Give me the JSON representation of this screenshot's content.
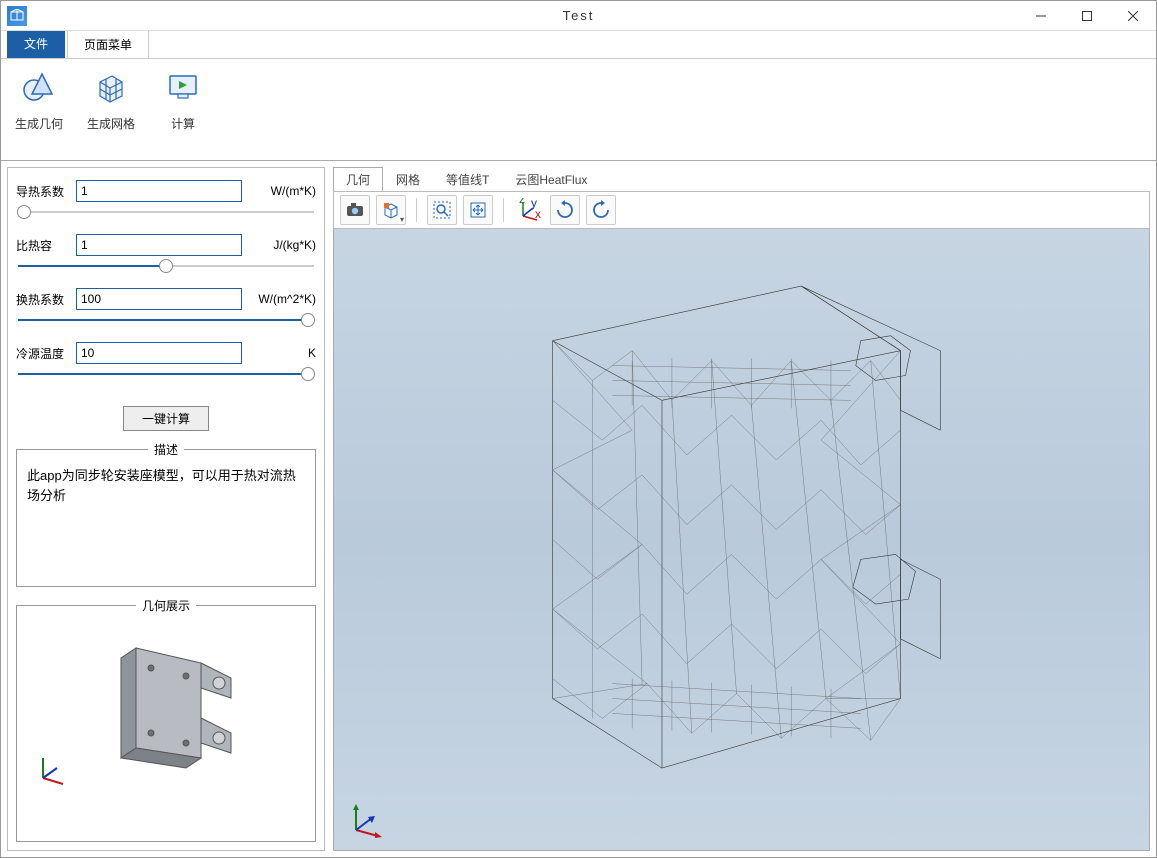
{
  "window": {
    "title": "Test"
  },
  "ribbon": {
    "tabs": {
      "file": "文件",
      "menu": "页面菜单"
    },
    "items": {
      "geom": "生成几何",
      "mesh": "生成网格",
      "compute": "计算"
    }
  },
  "params": {
    "thermal_conductivity": {
      "label": "导热系数",
      "value": "1",
      "unit": "W/(m*K)",
      "slider_pct": 2
    },
    "specific_heat": {
      "label": "比热容",
      "value": "1",
      "unit": "J/(kg*K)",
      "slider_pct": 50
    },
    "heat_transfer": {
      "label": "换热系数",
      "value": "100",
      "unit": "W/(m^2*K)",
      "slider_pct": 98
    },
    "cold_temp": {
      "label": "冷源温度",
      "value": "10",
      "unit": "K",
      "slider_pct": 98
    }
  },
  "buttons": {
    "one_click_calc": "一键计算"
  },
  "fieldsets": {
    "desc_title": "描述",
    "desc_text": "此app为同步轮安装座模型，可以用于热对流热场分析",
    "preview_title": "几何展示"
  },
  "view_tabs": {
    "geom": "几何",
    "mesh": "网格",
    "contour": "等值线T",
    "cloud": "云图HeatFlux"
  },
  "toolbar_icons": {
    "snapshot": "snapshot-icon",
    "transparency": "transparency-icon",
    "zoom_box": "zoom-box-icon",
    "zoom_extents": "zoom-extents-icon",
    "orientation": "orientation-axis-icon",
    "rotate_cw": "rotate-cw-icon",
    "rotate_ccw": "rotate-ccw-icon"
  }
}
